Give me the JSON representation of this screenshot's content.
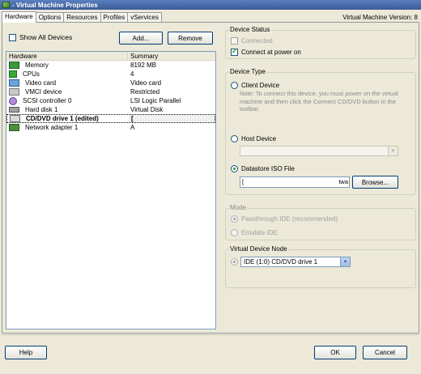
{
  "window": {
    "title": "- Virtual Machine Properties",
    "version_label": "Virtual Machine Version: 8"
  },
  "tabs": [
    {
      "label": "Hardware",
      "active": true
    },
    {
      "label": "Options",
      "active": false
    },
    {
      "label": "Resources",
      "active": false
    },
    {
      "label": "Profiles",
      "active": false
    },
    {
      "label": "vServices",
      "active": false
    }
  ],
  "left": {
    "show_all_label": "Show All Devices",
    "show_all_checked": false,
    "add_label": "Add...",
    "remove_label": "Remove"
  },
  "hardware_list": {
    "columns": [
      "Hardware",
      "Summary"
    ],
    "rows": [
      {
        "icon": "memory-icon",
        "name": "Memory",
        "summary": "8192 MB"
      },
      {
        "icon": "cpu-icon",
        "name": "CPUs",
        "summary": "4"
      },
      {
        "icon": "video-card-icon",
        "name": "Video card",
        "summary": "Video card"
      },
      {
        "icon": "vmci-device-icon",
        "name": "VMCI device",
        "summary": "Restricted"
      },
      {
        "icon": "scsi-controller-icon",
        "name": "SCSI controller 0",
        "summary": "LSI Logic Parallel"
      },
      {
        "icon": "hard-disk-icon",
        "name": "Hard disk 1",
        "summary": "Virtual Disk"
      },
      {
        "icon": "cd-dvd-drive-icon",
        "name": "CD/DVD drive 1 (edited)",
        "summary": "[ ",
        "selected": true
      },
      {
        "icon": "network-adapter-icon",
        "name": "Network adapter 1",
        "summary": "A"
      }
    ]
  },
  "device_status": {
    "title": "Device Status",
    "connected_label": "Connected",
    "connected_checked": false,
    "connect_power_label": "Connect at power on",
    "connect_power_checked": true
  },
  "device_type": {
    "title": "Device Type",
    "client_label": "Client Device",
    "client_note": "Note: To connect this device, you must power on the virtual machine and then click the Connect CD/DVD button in the toolbar.",
    "host_label": "Host Device",
    "host_value": "",
    "iso_label": "Datastore ISO File",
    "iso_selected": true,
    "iso_path": "[",
    "iso_path_tail": "twa",
    "browse_label": "Browse..."
  },
  "mode": {
    "title": "Mode",
    "passthrough_label": "Passthrough IDE (recommended)",
    "emulate_label": "Emulate IDE"
  },
  "virtual_device_node": {
    "title": "Virtual Device Node",
    "value": "IDE (1:0) CD/DVD drive 1"
  },
  "footer": {
    "help_label": "Help",
    "ok_label": "OK",
    "cancel_label": "Cancel"
  }
}
